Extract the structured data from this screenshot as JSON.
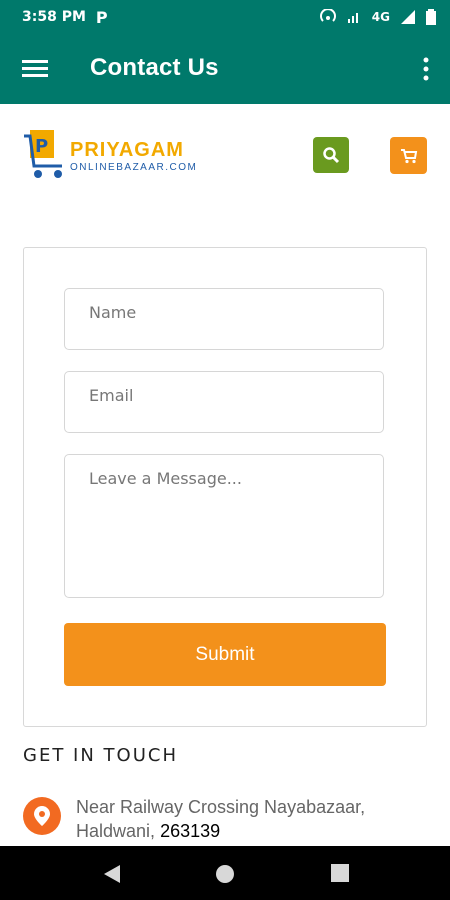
{
  "status": {
    "time": "3:58 PM",
    "app_icon": "P",
    "network": "4G"
  },
  "app_bar": {
    "title": "Contact Us",
    "menu_icon": "hamburger-menu-icon",
    "more_icon": "more-vertical-icon"
  },
  "header": {
    "logo_main": "PRIYAGAM",
    "logo_sub": "ONLINEBAZAAR.COM",
    "search_icon": "search-icon",
    "cart_icon": "cart-icon",
    "colors": {
      "primary": "#00796b",
      "search_bg": "#6a9a1f",
      "accent": "#f3911b",
      "logo_gold": "#f2a900",
      "logo_blue": "#1f5ca8"
    }
  },
  "form": {
    "name_placeholder": "Name",
    "email_placeholder": "Email",
    "message_placeholder": "Leave a Message...",
    "submit_label": "Submit"
  },
  "contact": {
    "title": "GET IN TOUCH",
    "address_text": "Near Railway Crossing Nayabazaar, Haldwani,",
    "pin_code": "263139",
    "location_icon": "location-pin-icon"
  },
  "nav": {
    "back_icon": "back-icon",
    "home_icon": "home-icon",
    "recent_icon": "recent-apps-icon"
  }
}
